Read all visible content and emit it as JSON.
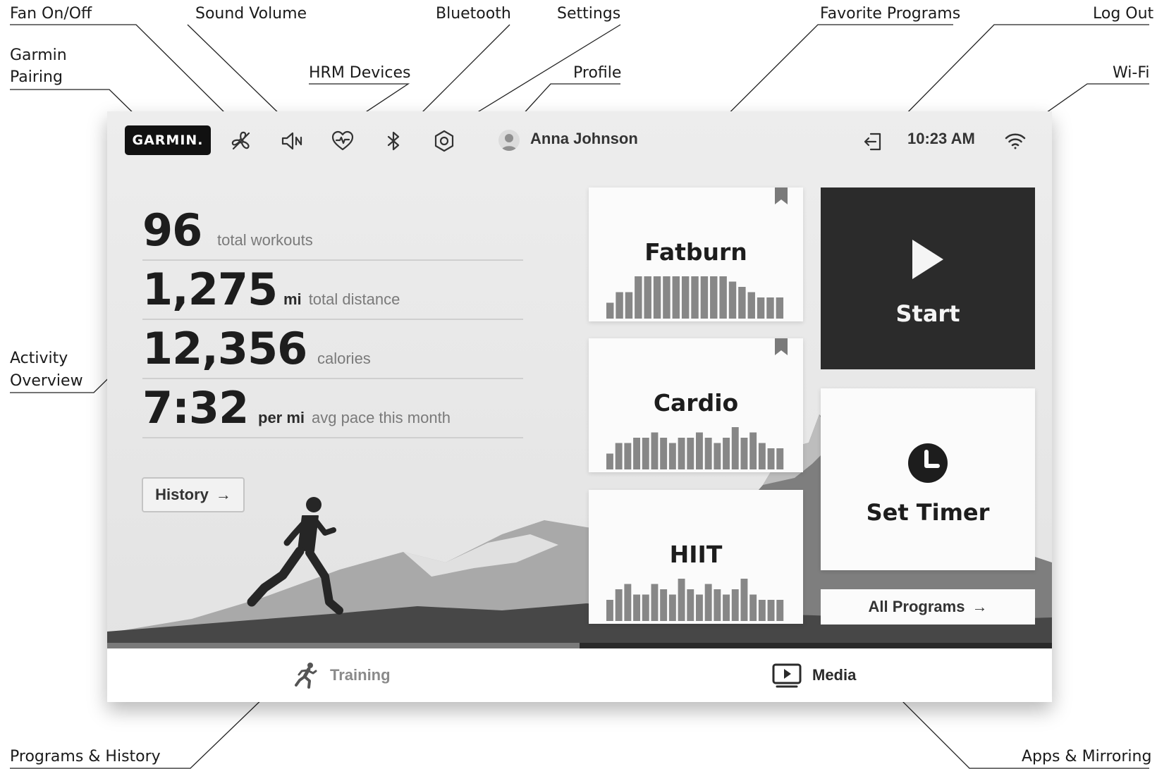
{
  "callouts": {
    "fan": "Fan On/Off",
    "sound": "Sound Volume",
    "bluetooth": "Bluetooth",
    "settings": "Settings",
    "favorites": "Favorite Programs",
    "logout": "Log Out",
    "garmin_line1": "Garmin",
    "garmin_line2": "Pairing",
    "hrm": "HRM Devices",
    "profile": "Profile",
    "wifi": "Wi-Fi",
    "activity_line1": "Activity",
    "activity_line2": "Overview",
    "programs_history": "Programs & History",
    "apps_mirroring": "Apps & Mirroring"
  },
  "header": {
    "logo_text": "GARMIN.",
    "user_name": "Anna Johnson",
    "time": "10:23 AM",
    "icons": [
      "fan-off-icon",
      "volume-icon",
      "heart-rate-icon",
      "bluetooth-icon",
      "settings-icon",
      "avatar",
      "logout-icon",
      "wifi-icon"
    ]
  },
  "stats": [
    {
      "value": "96",
      "unit": "",
      "label": "total workouts"
    },
    {
      "value": "1,275",
      "unit": "mi",
      "label": "total distance"
    },
    {
      "value": "12,356",
      "unit": "",
      "label": "calories"
    },
    {
      "value": "7:32",
      "unit": "per mi",
      "label": "avg pace this month"
    }
  ],
  "history_button": {
    "label": "History"
  },
  "programs": [
    {
      "name": "Fatburn",
      "favorite": true,
      "profile": [
        3,
        5,
        5,
        8,
        8,
        8,
        8,
        8,
        8,
        8,
        8,
        8,
        8,
        7,
        6,
        5,
        4,
        4,
        4
      ]
    },
    {
      "name": "Cardio",
      "favorite": true,
      "profile": [
        3,
        5,
        5,
        6,
        6,
        7,
        6,
        5,
        6,
        6,
        7,
        6,
        5,
        6,
        8,
        6,
        7,
        5,
        4,
        4
      ]
    },
    {
      "name": "HIIT",
      "favorite": false,
      "profile": [
        4,
        6,
        7,
        5,
        5,
        7,
        6,
        5,
        8,
        6,
        5,
        7,
        6,
        5,
        6,
        8,
        5,
        4,
        4,
        4
      ]
    }
  ],
  "tiles": {
    "start_label": "Start",
    "timer_label": "Set Timer",
    "all_programs_label": "All Programs"
  },
  "progress": 0.5,
  "nav": {
    "training_label": "Training",
    "media_label": "Media"
  },
  "colors": {
    "bar": "#878787",
    "start_tile": "#2b2b2b",
    "progress_fill": "#7a7a7a"
  }
}
